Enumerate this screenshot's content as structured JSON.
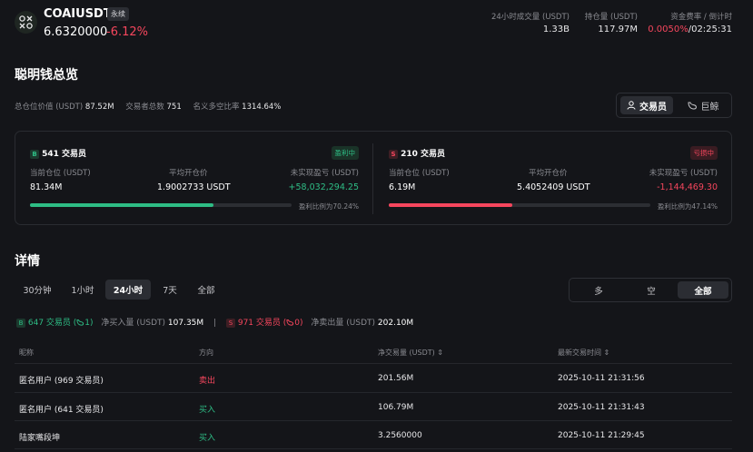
{
  "header": {
    "symbol": "COAIUSDT",
    "tag": "永续",
    "price": "6.6320000",
    "change": "-6.12%",
    "stats": [
      {
        "label": "24小时成交量 (USDT)",
        "value": "1.33B"
      },
      {
        "label": "持仓量 (USDT)",
        "value": "117.97M"
      },
      {
        "label": "资金费率 / 倒计时",
        "value_rate": "0.0050%",
        "value_sep": "/",
        "value_time": "02:25:31"
      }
    ]
  },
  "overview": {
    "title": "聪明钱总览",
    "total_position_label": "总仓位价值 (USDT)",
    "total_position_value": "87.52M",
    "traders_label": "交易者总数",
    "traders_value": "751",
    "ratio_label": "名义多空比率",
    "ratio_value": "1314.64%",
    "toggle": {
      "traders": "交易员",
      "whales": "巨鲸"
    }
  },
  "long_panel": {
    "badge": "B",
    "title": "541 交易员",
    "status": "盈利中",
    "pos_label": "当前仓位 (USDT)",
    "pos_value": "81.34M",
    "avg_label": "平均开仓价",
    "avg_value": "1.9002733 USDT",
    "pnl_label": "未实现盈亏 (USDT)",
    "pnl_value": "+58,032,294.25",
    "ratio_text": "盈利比例为70.24%",
    "ratio": 0.7024
  },
  "short_panel": {
    "badge": "S",
    "title": "210 交易员",
    "status": "亏损中",
    "pos_label": "当前仓位 (USDT)",
    "pos_value": "6.19M",
    "avg_label": "平均开仓价",
    "avg_value": "5.4052409 USDT",
    "pnl_label": "未实现盈亏 (USDT)",
    "pnl_value": "-1,144,469.30",
    "ratio_text": "盈利比例为47.14%",
    "ratio": 0.4714
  },
  "details": {
    "title": "详情",
    "timeframes": [
      "30分钟",
      "1小时",
      "24小时",
      "7天",
      "全部"
    ],
    "active_timeframe": "24小时",
    "sides": [
      "多",
      "空",
      "全部"
    ],
    "active_side": "全部",
    "buy_summary": {
      "badge": "B",
      "traders": "647 交易员 (",
      "whale_count": "1)",
      "net_label": "净买入量 (USDT)",
      "net_value": "107.35M"
    },
    "sell_summary": {
      "badge": "S",
      "traders": "971 交易员 (",
      "whale_count": "0)",
      "net_label": "净卖出量 (USDT)",
      "net_value": "202.10M"
    },
    "columns": [
      "昵称",
      "方向",
      "净交易量 (USDT) ⇕",
      "最新交易时间 ⇕"
    ],
    "rows": [
      {
        "name": "匿名用户 (969 交易员)",
        "side": "卖出",
        "side_color": "#f6465d",
        "volume": "201.56M",
        "time": "2025-10-11 21:31:56"
      },
      {
        "name": "匿名用户 (641 交易员)",
        "side": "买入",
        "side_color": "#2ebd85",
        "volume": "106.79M",
        "time": "2025-10-11 21:31:43"
      },
      {
        "name": "陆家嘴段坤",
        "side": "买入",
        "side_color": "#2ebd85",
        "volume": "3.2560000",
        "time": "2025-10-11 21:29:45"
      }
    ]
  }
}
